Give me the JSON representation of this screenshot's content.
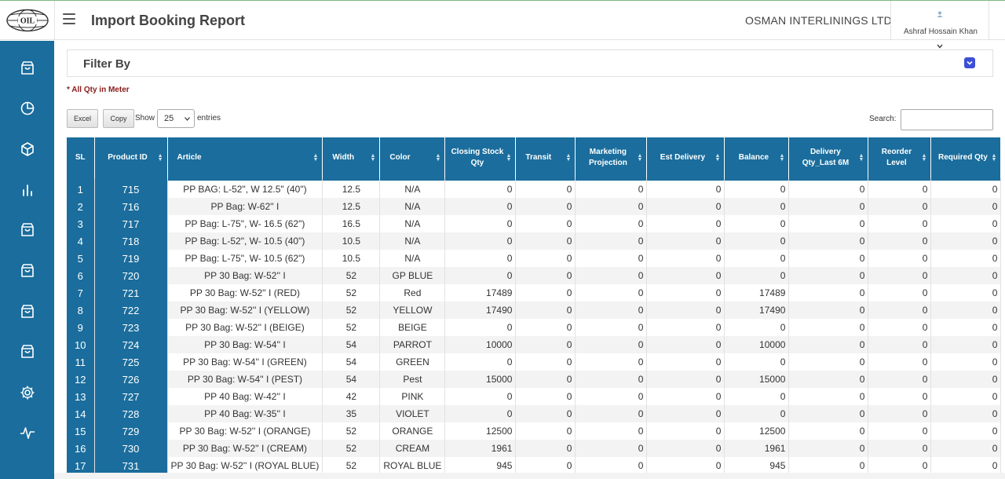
{
  "header": {
    "title": "Import Booking Report",
    "company": "OSMAN INTERLININGS LTD",
    "user_name": "Ashraf Hossain Khan",
    "logo_text": "OIL"
  },
  "sidebar": {
    "items": [
      {
        "icon": "bag-icon"
      },
      {
        "icon": "pie-chart-icon"
      },
      {
        "icon": "cube-icon"
      },
      {
        "icon": "bar-chart-icon"
      },
      {
        "icon": "bag-icon"
      },
      {
        "icon": "bag-icon"
      },
      {
        "icon": "bag-icon"
      },
      {
        "icon": "bag-icon"
      },
      {
        "icon": "gear-icon"
      },
      {
        "icon": "pulse-icon"
      }
    ],
    "color": "#1a6d9c"
  },
  "filter": {
    "title": "Filter By"
  },
  "note": "* All Qty in Meter",
  "toolbar": {
    "excel_label": "Excel",
    "copy_label": "Copy",
    "show_label": "Show",
    "entries_value": "25",
    "entries_label": "entries",
    "search_label": "Search:",
    "search_value": ""
  },
  "table": {
    "columns": [
      {
        "label": "SL"
      },
      {
        "label": "Product ID"
      },
      {
        "label": "Article"
      },
      {
        "label": "Width"
      },
      {
        "label": "Color"
      },
      {
        "label": "Closing Stock Qty"
      },
      {
        "label": "Transit"
      },
      {
        "label": "Marketing Projection"
      },
      {
        "label": "Est Delivery"
      },
      {
        "label": "Balance"
      },
      {
        "label": "Delivery Qty_Last 6M"
      },
      {
        "label": "Reorder Level"
      },
      {
        "label": "Required Qty"
      }
    ],
    "rows": [
      [
        "1",
        "715",
        "PP BAG: L-52\", W 12.5\" (40\")",
        "12.5",
        "N/A",
        "0",
        "0",
        "0",
        "0",
        "0",
        "0",
        "0",
        "0"
      ],
      [
        "2",
        "716",
        "PP Bag: W-62'' I",
        "12.5",
        "N/A",
        "0",
        "0",
        "0",
        "0",
        "0",
        "0",
        "0",
        "0"
      ],
      [
        "3",
        "717",
        "PP Bag: L-75\", W- 16.5 (62\")",
        "16.5",
        "N/A",
        "0",
        "0",
        "0",
        "0",
        "0",
        "0",
        "0",
        "0"
      ],
      [
        "4",
        "718",
        "PP Bag: L-52\", W- 10.5 (40\")",
        "10.5",
        "N/A",
        "0",
        "0",
        "0",
        "0",
        "0",
        "0",
        "0",
        "0"
      ],
      [
        "5",
        "719",
        "PP Bag: L-75\", W- 10.5 (62\")",
        "10.5",
        "N/A",
        "0",
        "0",
        "0",
        "0",
        "0",
        "0",
        "0",
        "0"
      ],
      [
        "6",
        "720",
        "PP 30 Bag: W-52'' I",
        "52",
        "GP BLUE",
        "0",
        "0",
        "0",
        "0",
        "0",
        "0",
        "0",
        "0"
      ],
      [
        "7",
        "721",
        "PP 30 Bag: W-52'' I (RED)",
        "52",
        "Red",
        "17489",
        "0",
        "0",
        "0",
        "17489",
        "0",
        "0",
        "0"
      ],
      [
        "8",
        "722",
        "PP 30 Bag: W-52'' I (YELLOW)",
        "52",
        "YELLOW",
        "17490",
        "0",
        "0",
        "0",
        "17490",
        "0",
        "0",
        "0"
      ],
      [
        "9",
        "723",
        "PP 30 Bag: W-52'' I (BEIGE)",
        "52",
        "BEIGE",
        "0",
        "0",
        "0",
        "0",
        "0",
        "0",
        "0",
        "0"
      ],
      [
        "10",
        "724",
        "PP 30 Bag: W-54'' I",
        "54",
        "PARROT",
        "10000",
        "0",
        "0",
        "0",
        "10000",
        "0",
        "0",
        "0"
      ],
      [
        "11",
        "725",
        "PP 30 Bag: W-54'' I (GREEN)",
        "54",
        "GREEN",
        "0",
        "0",
        "0",
        "0",
        "0",
        "0",
        "0",
        "0"
      ],
      [
        "12",
        "726",
        "PP 30 Bag: W-54'' I (PEST)",
        "54",
        "Pest",
        "15000",
        "0",
        "0",
        "0",
        "15000",
        "0",
        "0",
        "0"
      ],
      [
        "13",
        "727",
        "PP 40 Bag: W-42'' I",
        "42",
        "PINK",
        "0",
        "0",
        "0",
        "0",
        "0",
        "0",
        "0",
        "0"
      ],
      [
        "14",
        "728",
        "PP 40 Bag: W-35'' I",
        "35",
        "VIOLET",
        "0",
        "0",
        "0",
        "0",
        "0",
        "0",
        "0",
        "0"
      ],
      [
        "15",
        "729",
        "PP 30 Bag: W-52'' I (ORANGE)",
        "52",
        "ORANGE",
        "12500",
        "0",
        "0",
        "0",
        "12500",
        "0",
        "0",
        "0"
      ],
      [
        "16",
        "730",
        "PP 30 Bag: W-52'' I (CREAM)",
        "52",
        "CREAM",
        "1961",
        "0",
        "0",
        "0",
        "1961",
        "0",
        "0",
        "0"
      ],
      [
        "17",
        "731",
        "PP 30 Bag: W-52'' I (ROYAL BLUE)",
        "52",
        "ROYAL BLUE",
        "945",
        "0",
        "0",
        "0",
        "945",
        "0",
        "0",
        "0"
      ]
    ]
  }
}
